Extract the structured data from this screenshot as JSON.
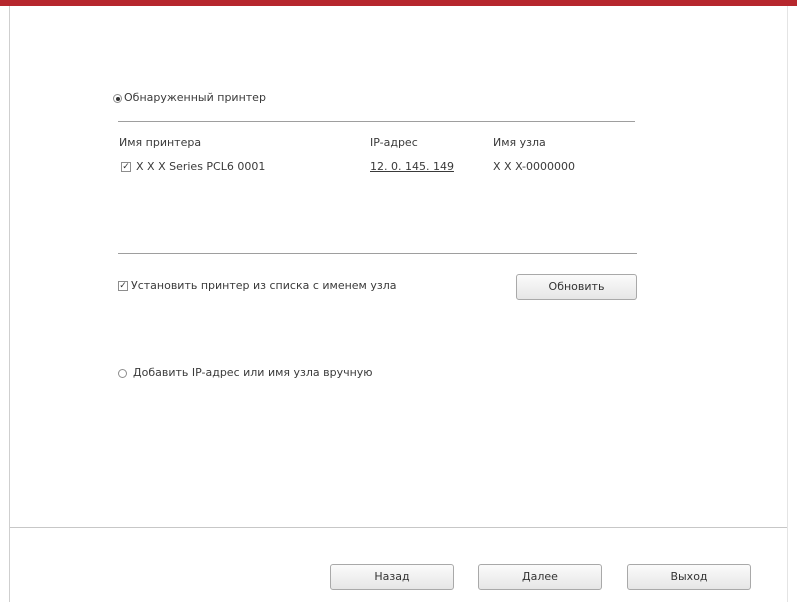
{
  "dialog": {
    "network_printer_option": "Обнаруженный принтер",
    "table": {
      "headers": {
        "name": "Имя принтера",
        "ip": "IP-адрес",
        "hostname": "Имя узла"
      },
      "rows": [
        {
          "name": "X X X Series PCL6 0001",
          "ip": "12. 0. 145. 149",
          "hostname": "X X X-0000000"
        }
      ]
    },
    "install_checkbox_label": "Установить принтер из списка с именем узла",
    "refresh_button": "Обновить",
    "manual_ip_option": "Добавить IP-адрес или имя узла вручную"
  },
  "footer": {
    "back_button": "Назад",
    "next_button": "Далее",
    "exit_button": "Выход"
  },
  "colors": {
    "accent_bar": "#b6272d"
  }
}
